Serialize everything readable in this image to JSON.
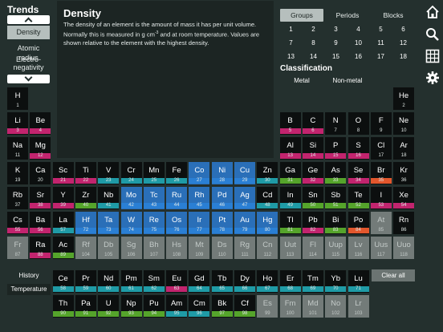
{
  "sidebar": {
    "title": "Trends",
    "items": [
      {
        "label": "Density",
        "active": true
      },
      {
        "label": "Atomic radius",
        "active": false
      },
      {
        "label": "Electro-negativity",
        "active": false
      }
    ]
  },
  "info": {
    "title": "Density",
    "line1": "The density of an element is the amount of mass it has per unit volume.",
    "line2a": "Normally this is measured in g cm",
    "line2sup": "-3",
    "line2b": " and at room temperature. Values are",
    "line3": "shown relative to the element with the highest density."
  },
  "tabs": [
    {
      "label": "Groups",
      "active": true
    },
    {
      "label": "Periods",
      "active": false
    },
    {
      "label": "Blocks",
      "active": false
    }
  ],
  "groups": [
    "1",
    "2",
    "3",
    "4",
    "5",
    "6",
    "7",
    "8",
    "9",
    "10",
    "11",
    "12",
    "13",
    "14",
    "15",
    "16",
    "17",
    "18"
  ],
  "classification": {
    "title": "Classification",
    "buttons": [
      "Metal",
      "Non-metal"
    ]
  },
  "bottom_buttons": {
    "history": "History",
    "temperature": "Temperature",
    "clear_all": "Clear all"
  },
  "colors": {
    "bar_magenta": "#c2246e",
    "bar_green": "#55a42b",
    "bar_teal": "#1f9ba6",
    "bar_blue": "#2a7fd4",
    "bar_orange": "#e2572d",
    "gray_cell": "#737b79"
  },
  "elements": [
    {
      "sym": "H",
      "num": "1",
      "bar": "none",
      "fill": 0
    },
    {
      "sym": "He",
      "num": "2",
      "bar": "none",
      "fill": 0
    },
    {
      "sym": "Li",
      "num": "3",
      "bar": "magenta",
      "fill": 1
    },
    {
      "sym": "Be",
      "num": "4",
      "bar": "magenta",
      "fill": 1
    },
    {
      "sym": "B",
      "num": "5",
      "bar": "magenta",
      "fill": 1
    },
    {
      "sym": "C",
      "num": "6",
      "bar": "magenta",
      "fill": 1
    },
    {
      "sym": "N",
      "num": "7",
      "bar": "none",
      "fill": 0
    },
    {
      "sym": "O",
      "num": "8",
      "bar": "none",
      "fill": 0
    },
    {
      "sym": "F",
      "num": "9",
      "bar": "none",
      "fill": 0
    },
    {
      "sym": "Ne",
      "num": "10",
      "bar": "none",
      "fill": 0
    },
    {
      "sym": "Na",
      "num": "11",
      "bar": "none",
      "fill": 0
    },
    {
      "sym": "Mg",
      "num": "12",
      "bar": "magenta",
      "fill": 1
    },
    {
      "sym": "Al",
      "num": "13",
      "bar": "magenta",
      "fill": 1
    },
    {
      "sym": "Si",
      "num": "14",
      "bar": "magenta",
      "fill": 1
    },
    {
      "sym": "P",
      "num": "15",
      "bar": "magenta",
      "fill": 1
    },
    {
      "sym": "S",
      "num": "16",
      "bar": "magenta",
      "fill": 1
    },
    {
      "sym": "Cl",
      "num": "17",
      "bar": "none",
      "fill": 0
    },
    {
      "sym": "Ar",
      "num": "18",
      "bar": "none",
      "fill": 0
    },
    {
      "sym": "K",
      "num": "19",
      "bar": "none",
      "fill": 0
    },
    {
      "sym": "Ca",
      "num": "20",
      "bar": "none",
      "fill": 0
    },
    {
      "sym": "Sc",
      "num": "21",
      "bar": "magenta",
      "fill": 1
    },
    {
      "sym": "Ti",
      "num": "22",
      "bar": "magenta",
      "fill": 1
    },
    {
      "sym": "V",
      "num": "23",
      "bar": "teal",
      "fill": 1
    },
    {
      "sym": "Cr",
      "num": "24",
      "bar": "teal",
      "fill": 1
    },
    {
      "sym": "Mn",
      "num": "25",
      "bar": "teal",
      "fill": 1
    },
    {
      "sym": "Fe",
      "num": "26",
      "bar": "teal",
      "fill": 1
    },
    {
      "sym": "Co",
      "num": "27",
      "bar": "blue",
      "fill": 1
    },
    {
      "sym": "Ni",
      "num": "28",
      "bar": "blue",
      "fill": 1
    },
    {
      "sym": "Cu",
      "num": "29",
      "bar": "blue",
      "fill": 1
    },
    {
      "sym": "Zn",
      "num": "30",
      "bar": "teal",
      "fill": 1
    },
    {
      "sym": "Ga",
      "num": "31",
      "bar": "green",
      "fill": 1
    },
    {
      "sym": "Ge",
      "num": "32",
      "bar": "magenta",
      "fill": 1
    },
    {
      "sym": "As",
      "num": "33",
      "bar": "green",
      "fill": 1
    },
    {
      "sym": "Se",
      "num": "34",
      "bar": "magenta",
      "fill": 1
    },
    {
      "sym": "Br",
      "num": "35",
      "bar": "orange",
      "fill": 1
    },
    {
      "sym": "Kr",
      "num": "36",
      "bar": "none",
      "fill": 0
    },
    {
      "sym": "Rb",
      "num": "37",
      "bar": "none",
      "fill": 0
    },
    {
      "sym": "Sr",
      "num": "38",
      "bar": "magenta",
      "fill": 1
    },
    {
      "sym": "Y",
      "num": "39",
      "bar": "magenta",
      "fill": 1
    },
    {
      "sym": "Zr",
      "num": "40",
      "bar": "green",
      "fill": 1
    },
    {
      "sym": "Nb",
      "num": "41",
      "bar": "teal",
      "fill": 1
    },
    {
      "sym": "Mo",
      "num": "42",
      "bar": "blue",
      "fill": 1
    },
    {
      "sym": "Tc",
      "num": "43",
      "bar": "blue",
      "fill": 1
    },
    {
      "sym": "Ru",
      "num": "44",
      "bar": "blue",
      "fill": 1
    },
    {
      "sym": "Rh",
      "num": "45",
      "bar": "blue",
      "fill": 1
    },
    {
      "sym": "Pd",
      "num": "46",
      "bar": "blue",
      "fill": 1
    },
    {
      "sym": "Ag",
      "num": "47",
      "bar": "blue",
      "fill": 1
    },
    {
      "sym": "Cd",
      "num": "48",
      "bar": "teal",
      "fill": 1
    },
    {
      "sym": "In",
      "num": "49",
      "bar": "teal",
      "fill": 1
    },
    {
      "sym": "Sn",
      "num": "50",
      "bar": "green",
      "fill": 1
    },
    {
      "sym": "Sb",
      "num": "51",
      "bar": "green",
      "fill": 1
    },
    {
      "sym": "Te",
      "num": "52",
      "bar": "green",
      "fill": 1
    },
    {
      "sym": "I",
      "num": "53",
      "bar": "magenta",
      "fill": 1
    },
    {
      "sym": "Xe",
      "num": "54",
      "bar": "magenta",
      "fill": 1
    },
    {
      "sym": "Cs",
      "num": "55",
      "bar": "magenta",
      "fill": 1
    },
    {
      "sym": "Ba",
      "num": "56",
      "bar": "magenta",
      "fill": 1
    },
    {
      "sym": "La",
      "num": "57",
      "bar": "teal",
      "fill": 1
    },
    {
      "sym": "Hf",
      "num": "72",
      "bar": "blue",
      "fill": 1
    },
    {
      "sym": "Ta",
      "num": "73",
      "bar": "blue",
      "fill": 1
    },
    {
      "sym": "W",
      "num": "74",
      "bar": "blue",
      "fill": 1
    },
    {
      "sym": "Re",
      "num": "75",
      "bar": "blue",
      "fill": 1
    },
    {
      "sym": "Os",
      "num": "76",
      "bar": "blue",
      "fill": 1
    },
    {
      "sym": "Ir",
      "num": "77",
      "bar": "blue",
      "fill": 1
    },
    {
      "sym": "Pt",
      "num": "78",
      "bar": "blue",
      "fill": 1
    },
    {
      "sym": "Au",
      "num": "79",
      "bar": "blue",
      "fill": 1
    },
    {
      "sym": "Hg",
      "num": "80",
      "bar": "blue",
      "fill": 1
    },
    {
      "sym": "Tl",
      "num": "81",
      "bar": "green",
      "fill": 1
    },
    {
      "sym": "Pb",
      "num": "82",
      "bar": "magenta",
      "fill": 1
    },
    {
      "sym": "Bi",
      "num": "83",
      "bar": "green",
      "fill": 1
    },
    {
      "sym": "Po",
      "num": "84",
      "bar": "orange",
      "fill": 1
    },
    {
      "sym": "At",
      "num": "85",
      "bar": "gray",
      "fill": 0
    },
    {
      "sym": "Rn",
      "num": "86",
      "bar": "none",
      "fill": 0
    },
    {
      "sym": "Fr",
      "num": "87",
      "bar": "gray",
      "fill": 0
    },
    {
      "sym": "Ra",
      "num": "88",
      "bar": "magenta",
      "fill": 1
    },
    {
      "sym": "Ac",
      "num": "89",
      "bar": "green",
      "fill": 1
    },
    {
      "sym": "Rf",
      "num": "104",
      "bar": "gray",
      "fill": 0
    },
    {
      "sym": "Db",
      "num": "105",
      "bar": "gray",
      "fill": 0
    },
    {
      "sym": "Sg",
      "num": "106",
      "bar": "gray",
      "fill": 0
    },
    {
      "sym": "Bh",
      "num": "107",
      "bar": "gray",
      "fill": 0
    },
    {
      "sym": "Hs",
      "num": "108",
      "bar": "gray",
      "fill": 0
    },
    {
      "sym": "Mt",
      "num": "109",
      "bar": "gray",
      "fill": 0
    },
    {
      "sym": "Ds",
      "num": "110",
      "bar": "gray",
      "fill": 0
    },
    {
      "sym": "Rg",
      "num": "111",
      "bar": "gray",
      "fill": 0
    },
    {
      "sym": "Cn",
      "num": "112",
      "bar": "gray",
      "fill": 0
    },
    {
      "sym": "Uut",
      "num": "113",
      "bar": "gray",
      "fill": 0
    },
    {
      "sym": "Fl",
      "num": "114",
      "bar": "gray",
      "fill": 0
    },
    {
      "sym": "Uup",
      "num": "115",
      "bar": "gray",
      "fill": 0
    },
    {
      "sym": "Lv",
      "num": "116",
      "bar": "gray",
      "fill": 0
    },
    {
      "sym": "Uus",
      "num": "117",
      "bar": "gray",
      "fill": 0
    },
    {
      "sym": "Uuo",
      "num": "118",
      "bar": "gray",
      "fill": 0
    },
    {
      "sym": "Ce",
      "num": "58",
      "bar": "teal",
      "fill": 1
    },
    {
      "sym": "Pr",
      "num": "59",
      "bar": "teal",
      "fill": 1
    },
    {
      "sym": "Nd",
      "num": "60",
      "bar": "teal",
      "fill": 1
    },
    {
      "sym": "Pm",
      "num": "61",
      "bar": "teal",
      "fill": 1
    },
    {
      "sym": "Sm",
      "num": "62",
      "bar": "teal",
      "fill": 1
    },
    {
      "sym": "Eu",
      "num": "63",
      "bar": "magenta",
      "fill": 1
    },
    {
      "sym": "Gd",
      "num": "64",
      "bar": "teal",
      "fill": 1
    },
    {
      "sym": "Tb",
      "num": "65",
      "bar": "teal",
      "fill": 1
    },
    {
      "sym": "Dy",
      "num": "66",
      "bar": "teal",
      "fill": 1
    },
    {
      "sym": "Ho",
      "num": "67",
      "bar": "teal",
      "fill": 1
    },
    {
      "sym": "Er",
      "num": "68",
      "bar": "teal",
      "fill": 1
    },
    {
      "sym": "Tm",
      "num": "69",
      "bar": "teal",
      "fill": 1
    },
    {
      "sym": "Yb",
      "num": "70",
      "bar": "teal",
      "fill": 1
    },
    {
      "sym": "Lu",
      "num": "71",
      "bar": "teal",
      "fill": 1
    },
    {
      "sym": "Th",
      "num": "90",
      "bar": "green",
      "fill": 1
    },
    {
      "sym": "Pa",
      "num": "91",
      "bar": "green",
      "fill": 1
    },
    {
      "sym": "U",
      "num": "92",
      "bar": "green",
      "fill": 1
    },
    {
      "sym": "Np",
      "num": "93",
      "bar": "green",
      "fill": 1
    },
    {
      "sym": "Pu",
      "num": "94",
      "bar": "green",
      "fill": 1
    },
    {
      "sym": "Am",
      "num": "95",
      "bar": "teal",
      "fill": 1
    },
    {
      "sym": "Cm",
      "num": "96",
      "bar": "teal",
      "fill": 1
    },
    {
      "sym": "Bk",
      "num": "97",
      "bar": "green",
      "fill": 1
    },
    {
      "sym": "Cf",
      "num": "98",
      "bar": "green",
      "fill": 1
    },
    {
      "sym": "Es",
      "num": "99",
      "bar": "gray",
      "fill": 0
    },
    {
      "sym": "Fm",
      "num": "100",
      "bar": "gray",
      "fill": 0
    },
    {
      "sym": "Md",
      "num": "101",
      "bar": "gray",
      "fill": 0
    },
    {
      "sym": "No",
      "num": "102",
      "bar": "gray",
      "fill": 0
    },
    {
      "sym": "Lr",
      "num": "103",
      "bar": "gray",
      "fill": 0
    }
  ]
}
